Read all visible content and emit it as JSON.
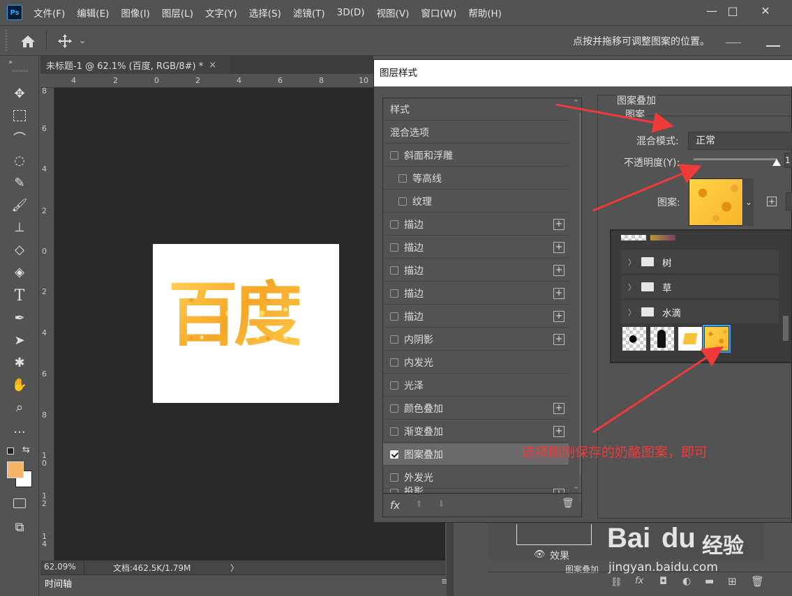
{
  "app": {
    "logo": "Ps"
  },
  "menu": [
    "文件(F)",
    "编辑(E)",
    "图像(I)",
    "图层(L)",
    "文字(Y)",
    "选择(S)",
    "滤镜(T)",
    "3D(D)",
    "视图(V)",
    "窗口(W)",
    "帮助(H)"
  ],
  "window_controls": {
    "minimize": "—",
    "maximize": "□",
    "close": "✕"
  },
  "options_bar": {
    "hint": "点按并拖移可调整图案的位置。"
  },
  "document": {
    "tab_title": "未标题-1 @ 62.1% (百度, RGB/8#) *",
    "tab_close": "×",
    "artboard_text": "百度",
    "zoom": "62.09%",
    "doc_info": "文档:462.5K/1.79M",
    "status_arrow": "〉",
    "ruler_h": [
      "4",
      "2",
      "0",
      "2",
      "4",
      "6",
      "8",
      "10"
    ],
    "ruler_v": [
      "8",
      "6",
      "4",
      "2",
      "0",
      "2",
      "4",
      "6",
      "8",
      "1 0",
      "1 2",
      "1 4"
    ]
  },
  "timeline": {
    "label": "时间轴"
  },
  "colors": {
    "foreground": "#f8b466",
    "background": "#ffffff",
    "accent": "#31a8ff",
    "annotation": "#f03a3a"
  },
  "dialog": {
    "title": "图层样式",
    "styles": [
      {
        "label": "样式",
        "checkbox": false,
        "plus": false,
        "indent": false,
        "selected": false
      },
      {
        "label": "混合选项",
        "checkbox": false,
        "plus": false,
        "indent": false,
        "selected": false
      },
      {
        "label": "斜面和浮雕",
        "checkbox": true,
        "checked": false,
        "plus": false,
        "indent": false,
        "selected": false
      },
      {
        "label": "等高线",
        "checkbox": true,
        "checked": false,
        "plus": false,
        "indent": true,
        "selected": false
      },
      {
        "label": "纹理",
        "checkbox": true,
        "checked": false,
        "plus": false,
        "indent": true,
        "selected": false
      },
      {
        "label": "描边",
        "checkbox": true,
        "checked": false,
        "plus": true,
        "indent": false,
        "selected": false
      },
      {
        "label": "描边",
        "checkbox": true,
        "checked": false,
        "plus": true,
        "indent": false,
        "selected": false
      },
      {
        "label": "描边",
        "checkbox": true,
        "checked": false,
        "plus": true,
        "indent": false,
        "selected": false
      },
      {
        "label": "描边",
        "checkbox": true,
        "checked": false,
        "plus": true,
        "indent": false,
        "selected": false
      },
      {
        "label": "描边",
        "checkbox": true,
        "checked": false,
        "plus": true,
        "indent": false,
        "selected": false
      },
      {
        "label": "内阴影",
        "checkbox": true,
        "checked": false,
        "plus": true,
        "indent": false,
        "selected": false
      },
      {
        "label": "内发光",
        "checkbox": true,
        "checked": false,
        "plus": false,
        "indent": false,
        "selected": false
      },
      {
        "label": "光泽",
        "checkbox": true,
        "checked": false,
        "plus": false,
        "indent": false,
        "selected": false
      },
      {
        "label": "颜色叠加",
        "checkbox": true,
        "checked": false,
        "plus": true,
        "indent": false,
        "selected": false
      },
      {
        "label": "渐变叠加",
        "checkbox": true,
        "checked": false,
        "plus": true,
        "indent": false,
        "selected": false
      },
      {
        "label": "图案叠加",
        "checkbox": true,
        "checked": true,
        "plus": false,
        "indent": false,
        "selected": true
      },
      {
        "label": "外发光",
        "checkbox": true,
        "checked": false,
        "plus": false,
        "indent": false,
        "selected": false
      },
      {
        "label": "投影",
        "checkbox": true,
        "checked": false,
        "plus": true,
        "indent": false,
        "selected": false
      }
    ],
    "footer": {
      "fx": "fx",
      "up": "⬆",
      "down": "⬇",
      "trash": "🗑"
    },
    "section_title": "图案叠加",
    "group_title": "图案",
    "blend_label": "混合模式:",
    "blend_value": "正常",
    "opacity_label": "不透明度(Y):",
    "opacity_value": "1",
    "opacity_fraction": 1.0,
    "pattern_label": "图案:",
    "picker": {
      "folders": [
        "树",
        "草",
        "水滴"
      ]
    }
  },
  "annotation": "选择刚刚保存的奶酪图案，即可",
  "layers_panel": {
    "effects_label": "效果",
    "pattern_overlay_label": "图案叠加"
  },
  "watermark": {
    "brand": "Bai",
    "paw": "du",
    "brand_cn": "经验",
    "url": "jingyan.baidu.com"
  }
}
